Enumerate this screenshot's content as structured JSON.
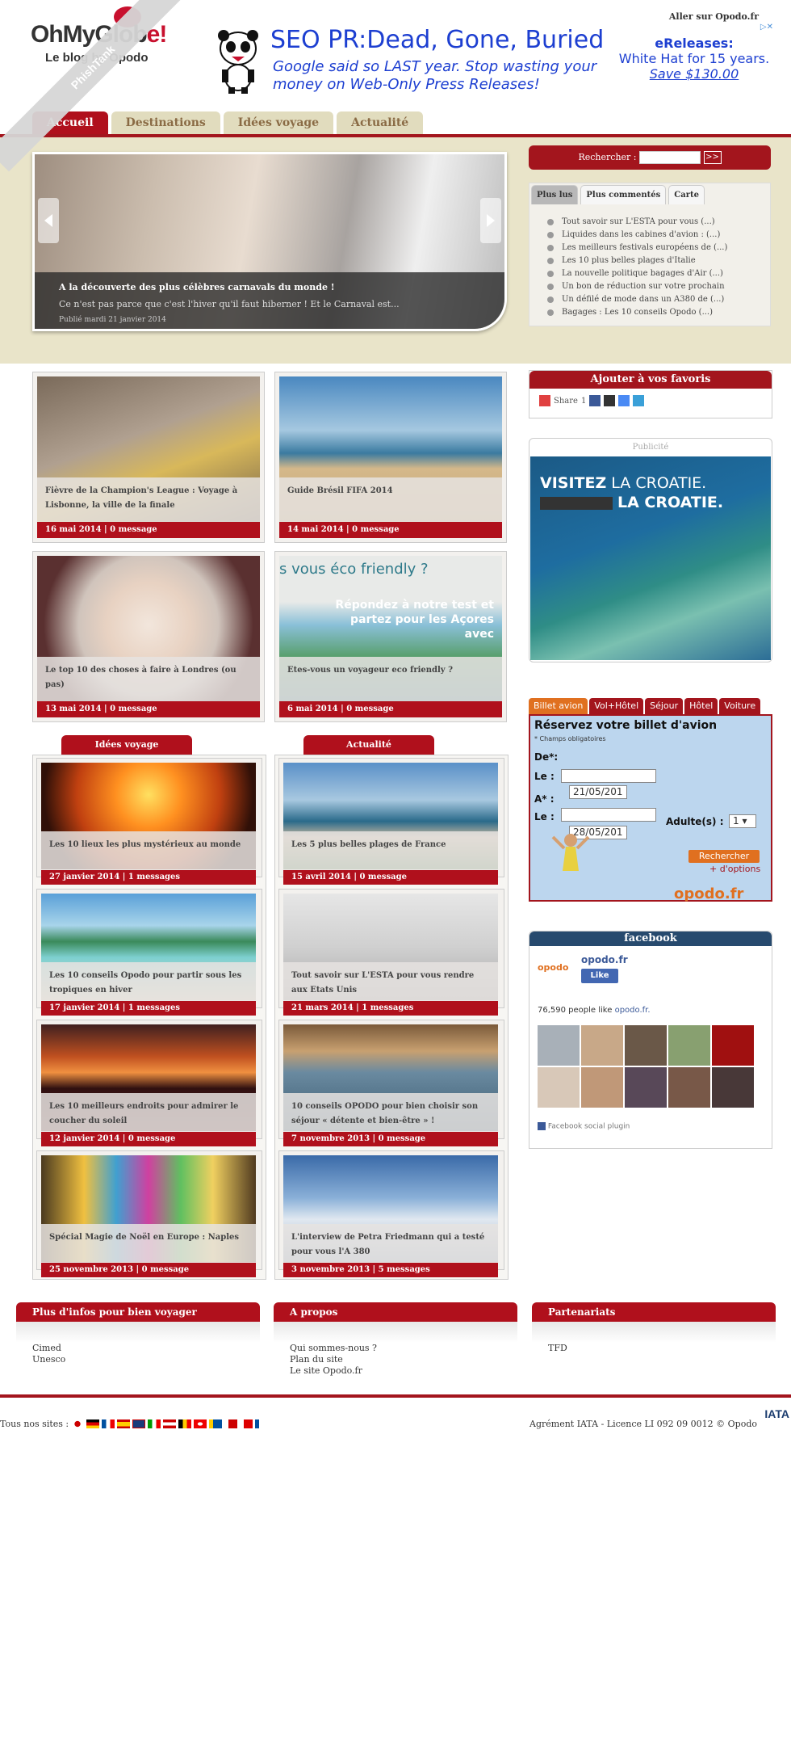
{
  "header": {
    "top_link": "Aller sur Opodo.fr",
    "logo_main": "OhMyGlob",
    "logo_accent": "e!",
    "logo_sub": "Le blog by Opodo"
  },
  "ad": {
    "title": "SEO PR:Dead, Gone, Buried",
    "subtitle": "Google said so LAST year. Stop wasting your money on Web-Only Press Releases!",
    "brand": "eReleases:",
    "tag": "White Hat for 15 years.",
    "offer": "Save $130.00",
    "choices": "▷✕"
  },
  "ribbon": "PhishTank",
  "nav": {
    "tabs": [
      {
        "label": "Accueil"
      },
      {
        "label": "Destinations"
      },
      {
        "label": "Idées voyage"
      },
      {
        "label": "Actualité"
      }
    ]
  },
  "slider": {
    "title": "A la découverte des plus célèbres carnavals du monde !",
    "desc": "Ce n'est pas parce que c'est l'hiver qu'il faut hiberner ! Et le Carnaval est...",
    "published": "Publié mardi 21 janvier 2014"
  },
  "search": {
    "label": "Rechercher :",
    "button": ">>",
    "value": ""
  },
  "popular": {
    "tabs": [
      "Plus lus",
      "Plus commentés",
      "Carte"
    ],
    "items": [
      "Tout savoir sur L'ESTA pour vous (...)",
      "Liquides dans les cabines d'avion : (...)",
      "Les meilleurs festivals européens de (...)",
      "Les 10 plus belles plages d'Italie",
      "La nouvelle politique bagages d'Air (...)",
      "Un bon de réduction sur votre prochain",
      "Un défilé de mode dans un A380 de (...)",
      "Bagages : Les 10 conseils Opodo (...)"
    ]
  },
  "featured": [
    {
      "title": "Fièvre de la Champion's League : Voyage à Lisbonne, la ville de la finale",
      "meta": "16 mai 2014 | 0 message"
    },
    {
      "title": "Guide Brésil FIFA 2014",
      "meta": "14 mai 2014 | 0 message"
    },
    {
      "title": "Le top 10 des choses à faire à Londres (ou pas)",
      "meta": "13 mai 2014 | 0 message"
    },
    {
      "title": "Etes-vous un voyageur eco friendly ?",
      "meta": "6 mai 2014 | 0 message",
      "img_text1": "s vous éco friendly ?",
      "img_text2": "Répondez à notre test et partez pour les Açores avec"
    }
  ],
  "columns": {
    "left_title": "Idées voyage",
    "right_title": "Actualité",
    "left": [
      {
        "title": "Les 10 lieux les plus mystérieux au monde",
        "meta": "27 janvier 2014 | 1 messages"
      },
      {
        "title": "Les 10 conseils Opodo pour partir sous les tropiques en hiver",
        "meta": "17 janvier 2014 | 1 messages"
      },
      {
        "title": "Les 10 meilleurs endroits pour admirer le coucher du soleil",
        "meta": "12 janvier 2014 | 0 message"
      },
      {
        "title": "Spécial Magie de Noël en Europe : Naples",
        "meta": "25 novembre 2013 | 0 message"
      }
    ],
    "right": [
      {
        "title": "Les 5 plus belles plages de France",
        "meta": "15 avril 2014 | 0 message"
      },
      {
        "title": "Tout savoir sur L'ESTA pour vous rendre aux Etats Unis",
        "meta": "21 mars 2014 | 1 messages"
      },
      {
        "title": "10 conseils OPODO pour bien choisir son séjour « détente et bien-être » !",
        "meta": "7 novembre 2013 | 0 message"
      },
      {
        "title": "L'interview de Petra Friedmann qui a testé pour vous l'A 380",
        "meta": "3 novembre 2013 | 5 messages"
      }
    ]
  },
  "favorites": {
    "title": "Ajouter à vos favoris",
    "share": "Share",
    "count": "1"
  },
  "pub": {
    "label": "Publicité",
    "line1a": "VISITEZ",
    "line1b": " LA CROATIE.",
    "line2": "LA CROATIE."
  },
  "booking": {
    "tabs": [
      "Billet avion",
      "Vol+Hôtel",
      "Séjour",
      "Hôtel",
      "Voiture"
    ],
    "title": "Réservez votre billet d'avion",
    "required": "* Champs obligatoires",
    "from_label": "De*:",
    "le1": "Le :",
    "date1": "21/05/201",
    "to_label": "A* :",
    "le2": "Le :",
    "date2": "28/05/201",
    "adults_label": "Adulte(s) :",
    "adults": "1",
    "button": "Rechercher",
    "options": "+ d'options",
    "brand": "opodo.fr"
  },
  "facebook": {
    "title": "facebook",
    "page": "opodo.fr",
    "logo": "opodo",
    "like": "Like",
    "count_text": "76,590 people like ",
    "count_link": "opodo.fr.",
    "plugin": "Facebook social plugin"
  },
  "footer": {
    "boxes": [
      {
        "title": "Plus d'infos pour bien voyager",
        "links": [
          "Cimed",
          "Unesco"
        ]
      },
      {
        "title": "A propos",
        "links": [
          "Qui sommes-nous ?",
          "Plan du site",
          "Le site Opodo.fr"
        ]
      },
      {
        "title": "Partenariats",
        "links": [
          "TFD"
        ]
      }
    ],
    "sites_label": "Tous nos sites :",
    "legal": "Agrément IATA - Licence LI 092 09 0012 © Opodo",
    "iata": "IATA"
  },
  "colors": {
    "accent": "#b0101c",
    "band": "#e9e4c9",
    "orange": "#e07020"
  }
}
